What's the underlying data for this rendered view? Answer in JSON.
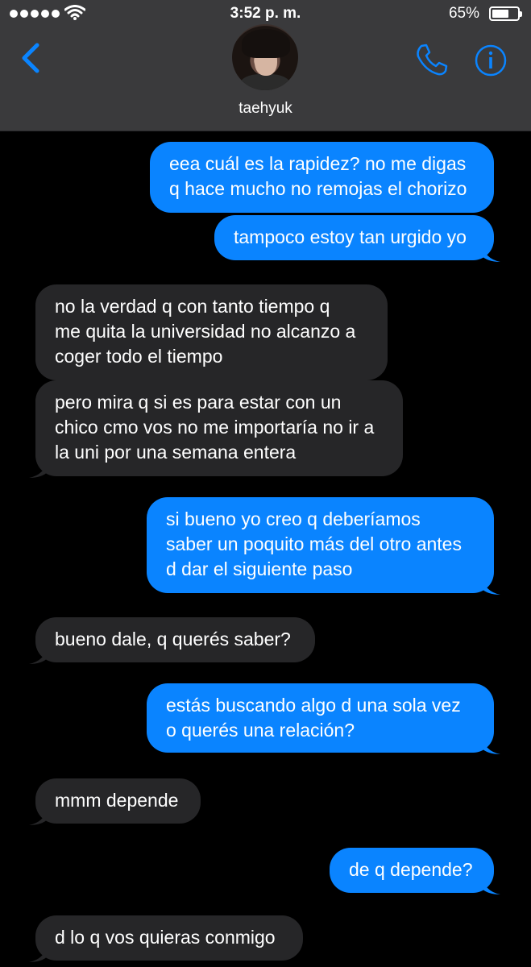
{
  "status_bar": {
    "time": "3:52 p. m.",
    "battery_percent": "65%",
    "battery_level": 0.65,
    "signal_dots": 5
  },
  "header": {
    "contact_name": "taehyuk",
    "back_icon": "chevron-left-icon",
    "call_icon": "phone-icon",
    "info_icon": "info-icon"
  },
  "colors": {
    "header_bg": "#3a3a3c",
    "outgoing_bubble": "#0a84ff",
    "incoming_bubble": "#262628",
    "accent": "#0a84ff",
    "background": "#000000"
  },
  "messages": [
    {
      "direction": "outgoing",
      "lines": [
        "eea cuál es la rapidez? no me digas",
        "q hace mucho no remojas el chorizo"
      ],
      "tail": false
    },
    {
      "direction": "outgoing",
      "lines": [
        "tampoco estoy tan urgido yo"
      ],
      "tail": true
    },
    {
      "direction": "incoming",
      "lines": [
        "no la verdad q con tanto tiempo q",
        "me quita la universidad no alcanzo a",
        "coger todo el tiempo"
      ],
      "tail": false
    },
    {
      "direction": "incoming",
      "lines": [
        "pero mira q si es para estar con un",
        "chico cmo vos no me importaría no ir a",
        "la uni por una semana entera"
      ],
      "tail": true
    },
    {
      "direction": "outgoing",
      "lines": [
        "si bueno yo creo q deberíamos",
        "saber un poquito más del otro antes",
        "d dar el siguiente paso"
      ],
      "tail": true
    },
    {
      "direction": "incoming",
      "lines": [
        "bueno dale, q querés saber?"
      ],
      "tail": true
    },
    {
      "direction": "outgoing",
      "lines": [
        "estás buscando algo d una sola vez",
        "o querés una relación?"
      ],
      "tail": true
    },
    {
      "direction": "incoming",
      "lines": [
        "mmm depende"
      ],
      "tail": true
    },
    {
      "direction": "outgoing",
      "lines": [
        "de q depende?"
      ],
      "tail": true
    },
    {
      "direction": "incoming",
      "lines": [
        "d lo q vos quieras conmigo"
      ],
      "tail": true
    }
  ]
}
